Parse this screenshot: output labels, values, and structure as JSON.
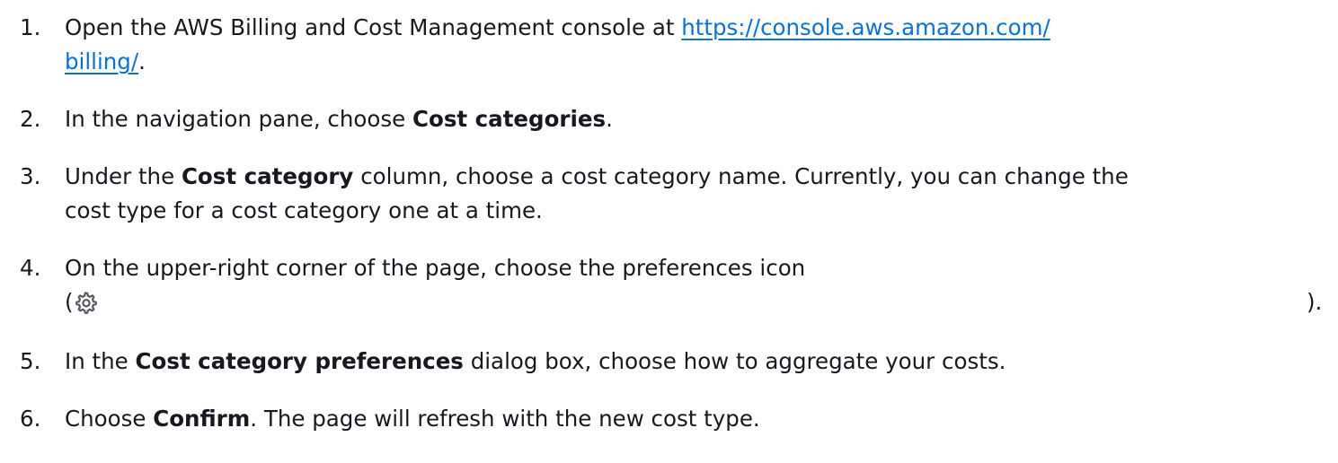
{
  "steps": [
    {
      "number": "1.",
      "before": "Open the AWS Billing and Cost Management console at ",
      "link_part1": "https://console.aws.amazon.com/",
      "link_part2": "billing/",
      "after": "."
    },
    {
      "number": "2.",
      "before": "In the navigation pane, choose ",
      "bold": "Cost categories",
      "after": "."
    },
    {
      "number": "3.",
      "before": "Under the ",
      "bold": "Cost category",
      "after": " column, choose a cost category name. Currently, you can change the",
      "line2": "cost type for a cost category one at a time."
    },
    {
      "number": "4.",
      "line1": "On the upper-right corner of the page, choose the preferences icon",
      "paren_open": "(",
      "icon": "gear-icon",
      "paren_close": ")."
    },
    {
      "number": "5.",
      "before": "In the ",
      "bold": "Cost category preferences",
      "after": " dialog box, choose how to aggregate your costs."
    },
    {
      "number": "6.",
      "before": "Choose ",
      "bold": "Confirm",
      "after": ". The page will refresh with the new cost type."
    }
  ],
  "colors": {
    "text": "#16191f",
    "link": "#0972d3",
    "icon": "#545b64"
  }
}
